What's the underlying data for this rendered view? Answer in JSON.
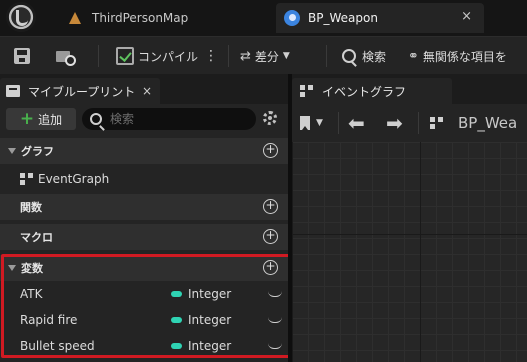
{
  "tabs": [
    {
      "label": "ThirdPersonMap",
      "icon": "map-icon"
    },
    {
      "label": "BP_Weapon",
      "icon": "blueprint-icon",
      "close": "×"
    }
  ],
  "toolbar": {
    "compile_label": "コンパイル",
    "diff_label": "差分",
    "search_label": "検索",
    "unrelated_label": "無関係な項目を"
  },
  "my_blueprint": {
    "tab_label": "マイブループリント",
    "tab_close": "×",
    "add_label": "追加",
    "search_placeholder": "検索",
    "sections": {
      "graph": "グラフ",
      "functions": "関数",
      "macros": "マクロ",
      "variables": "変数"
    },
    "event_graph": "EventGraph",
    "variables": [
      {
        "name": "ATK",
        "type": "Integer"
      },
      {
        "name": "Rapid fire",
        "type": "Integer"
      },
      {
        "name": "Bullet speed",
        "type": "Integer"
      }
    ]
  },
  "graph_panel": {
    "tab_label": "イベントグラフ",
    "breadcrumb": "BP_Wea"
  },
  "colors": {
    "integer_pin": "#2fd3b3",
    "highlight_border": "#d01a22"
  }
}
